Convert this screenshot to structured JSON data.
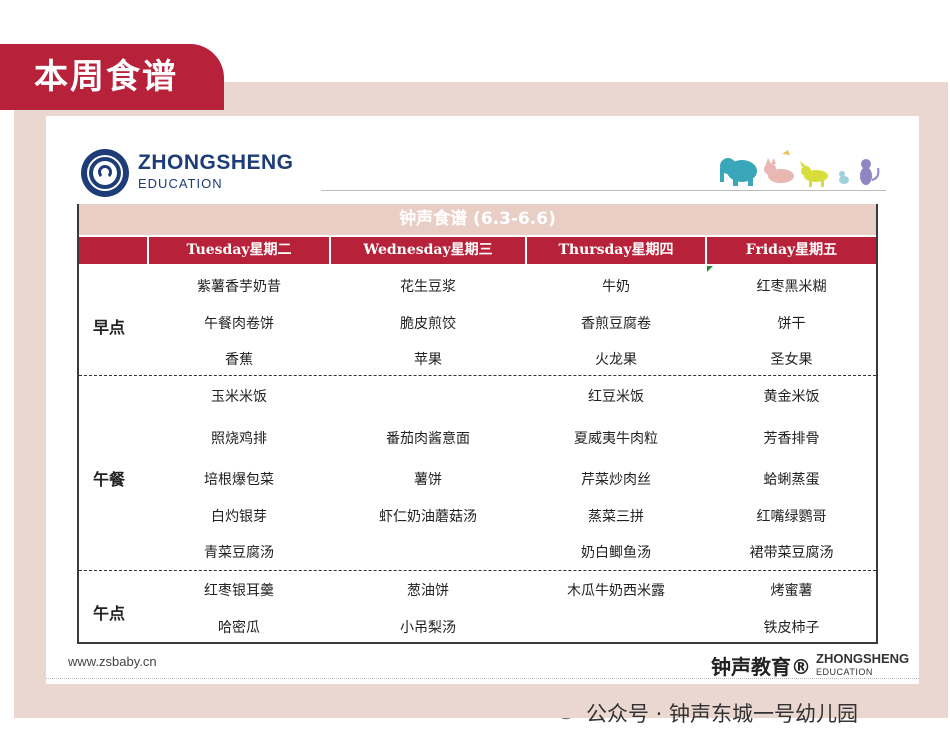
{
  "header_tag": "本周食谱",
  "brand": {
    "line1": "ZHONGSHENG",
    "line2": "EDUCATION"
  },
  "menu": {
    "title": "钟声食谱    (6.3-6.6)",
    "days": [
      "Tuesday星期二",
      "Wednesday星期三",
      "Thursday星期四",
      "Friday星期五"
    ],
    "meals": [
      {
        "name": "早点",
        "rows": [
          [
            "紫薯香芋奶昔",
            "花生豆浆",
            "牛奶",
            "红枣黑米糊"
          ],
          [
            "午餐肉卷饼",
            "脆皮煎饺",
            "香煎豆腐卷",
            "饼干"
          ],
          [
            "香蕉",
            "苹果",
            "火龙果",
            "圣女果"
          ]
        ]
      },
      {
        "name": "午餐",
        "rows": [
          [
            "玉米米饭",
            "",
            "红豆米饭",
            "黄金米饭"
          ],
          [
            "照烧鸡排",
            "番茄肉酱意面",
            "夏威夷牛肉粒",
            "芳香排骨"
          ],
          [
            "培根爆包菜",
            "薯饼",
            "芹菜炒肉丝",
            "蛤蜊蒸蛋"
          ],
          [
            "白灼银芽",
            "虾仁奶油蘑菇汤",
            "蒸菜三拼",
            "红嘴绿鹦哥"
          ],
          [
            "青菜豆腐汤",
            "",
            "奶白鲫鱼汤",
            "裙带菜豆腐汤"
          ]
        ]
      },
      {
        "name": "午点",
        "rows": [
          [
            "红枣银耳羹",
            "葱油饼",
            "木瓜牛奶西米露",
            "烤蜜薯"
          ],
          [
            "哈密瓜",
            "小吊梨汤",
            "",
            "铁皮柿子"
          ]
        ]
      }
    ]
  },
  "footer": {
    "url": "www.zsbaby.cn",
    "brand_cn": "钟声教育®",
    "brand_en1": "ZHONGSHENG",
    "brand_en2": "EDUCATION"
  },
  "account": "公众号 · 钟声东城一号幼儿园",
  "colors": {
    "accent": "#b7223a",
    "title_band": "#e8cec4",
    "frame": "#ead8d0",
    "brand_blue": "#1e3c78"
  }
}
